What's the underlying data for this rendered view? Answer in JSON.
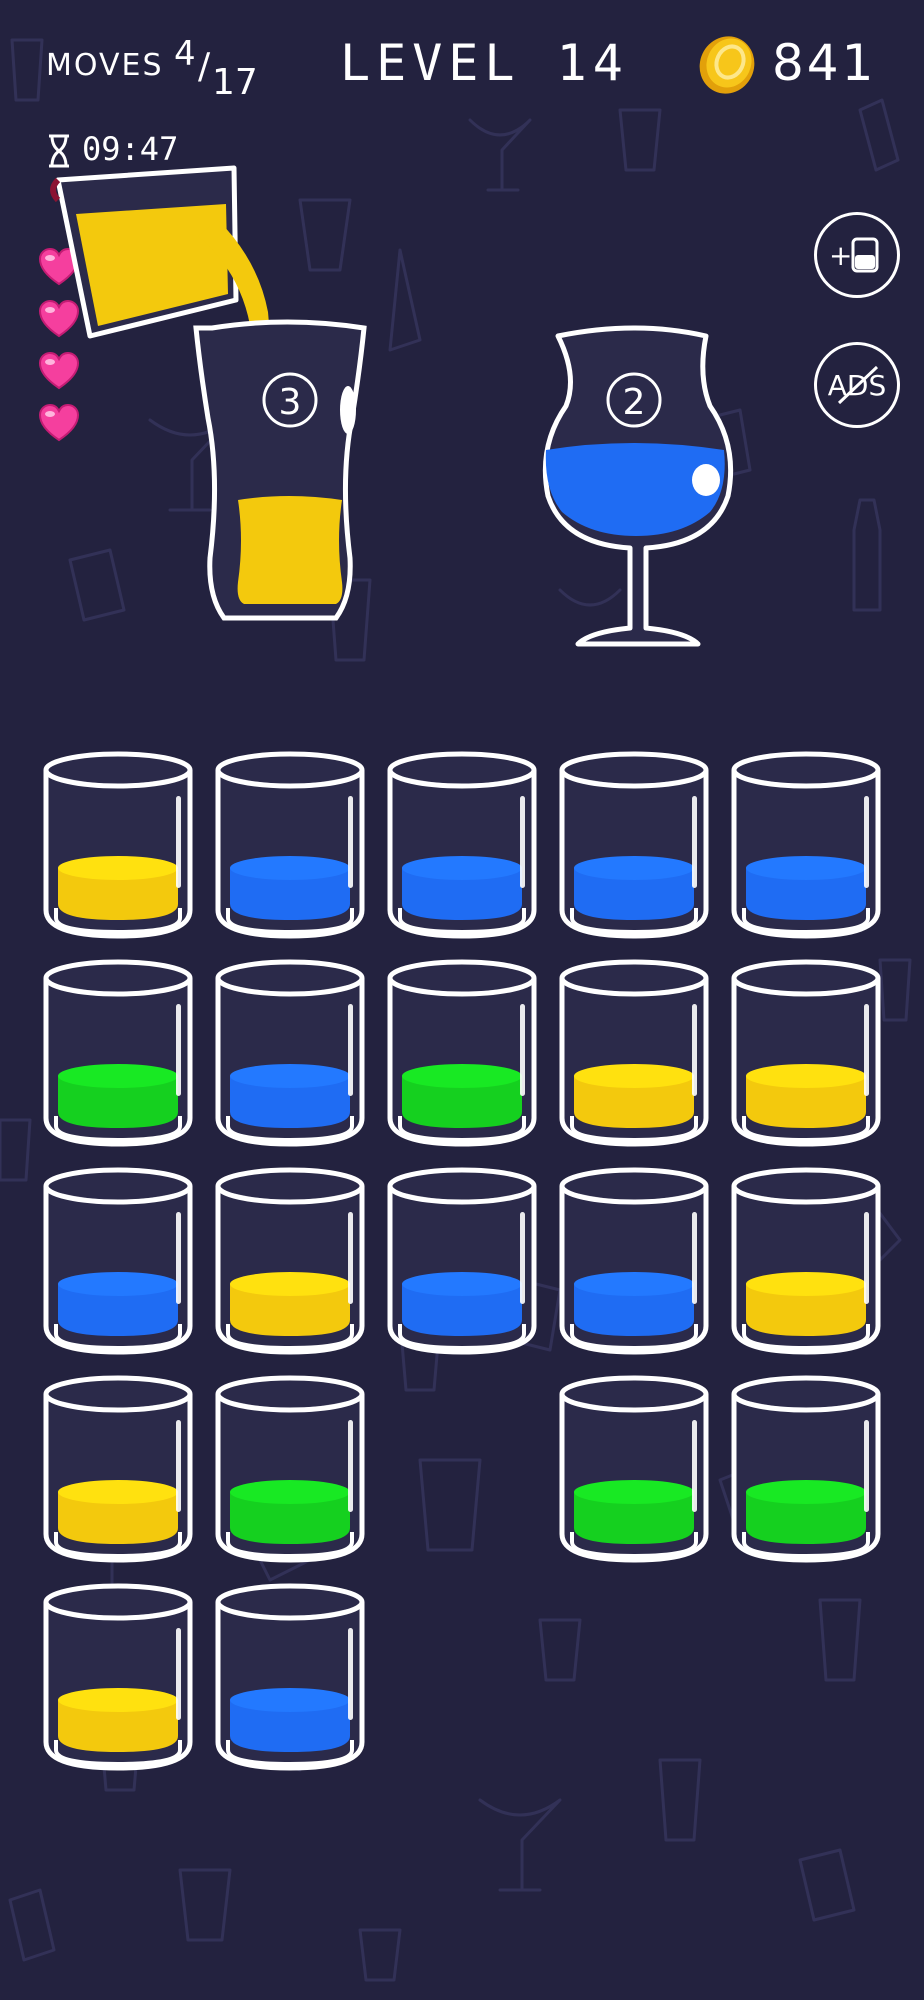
{
  "hud": {
    "moves_label": "MOVES",
    "moves_current": "4",
    "moves_max": "17",
    "level_title": "LEVEL 14",
    "coins": "841",
    "timer": "09:47",
    "hearts": 4,
    "coin_icon": "gold-coin-icon",
    "timer_icon": "hourglass-icon",
    "heart_icon": "heart-icon"
  },
  "buttons": {
    "add_tube_icon": "add-tube-icon",
    "no_ads_label": "ADS"
  },
  "serving_glasses": [
    {
      "number": "3",
      "liquid": "yellow"
    },
    {
      "number": "2",
      "liquid": "blue"
    }
  ],
  "colors": {
    "background": "#23223f",
    "yellow": "#f3c90d",
    "blue": "#1f6cf3",
    "green": "#15d01f",
    "glass": "#ffffff"
  },
  "tubes": [
    "yellow",
    "blue",
    "blue",
    "blue",
    "blue",
    "green",
    "blue",
    "green",
    "yellow",
    "yellow",
    "blue",
    "yellow",
    "blue",
    "blue",
    "yellow",
    "yellow",
    "green",
    null,
    "green",
    "green",
    "yellow",
    "blue",
    null,
    null,
    null
  ]
}
